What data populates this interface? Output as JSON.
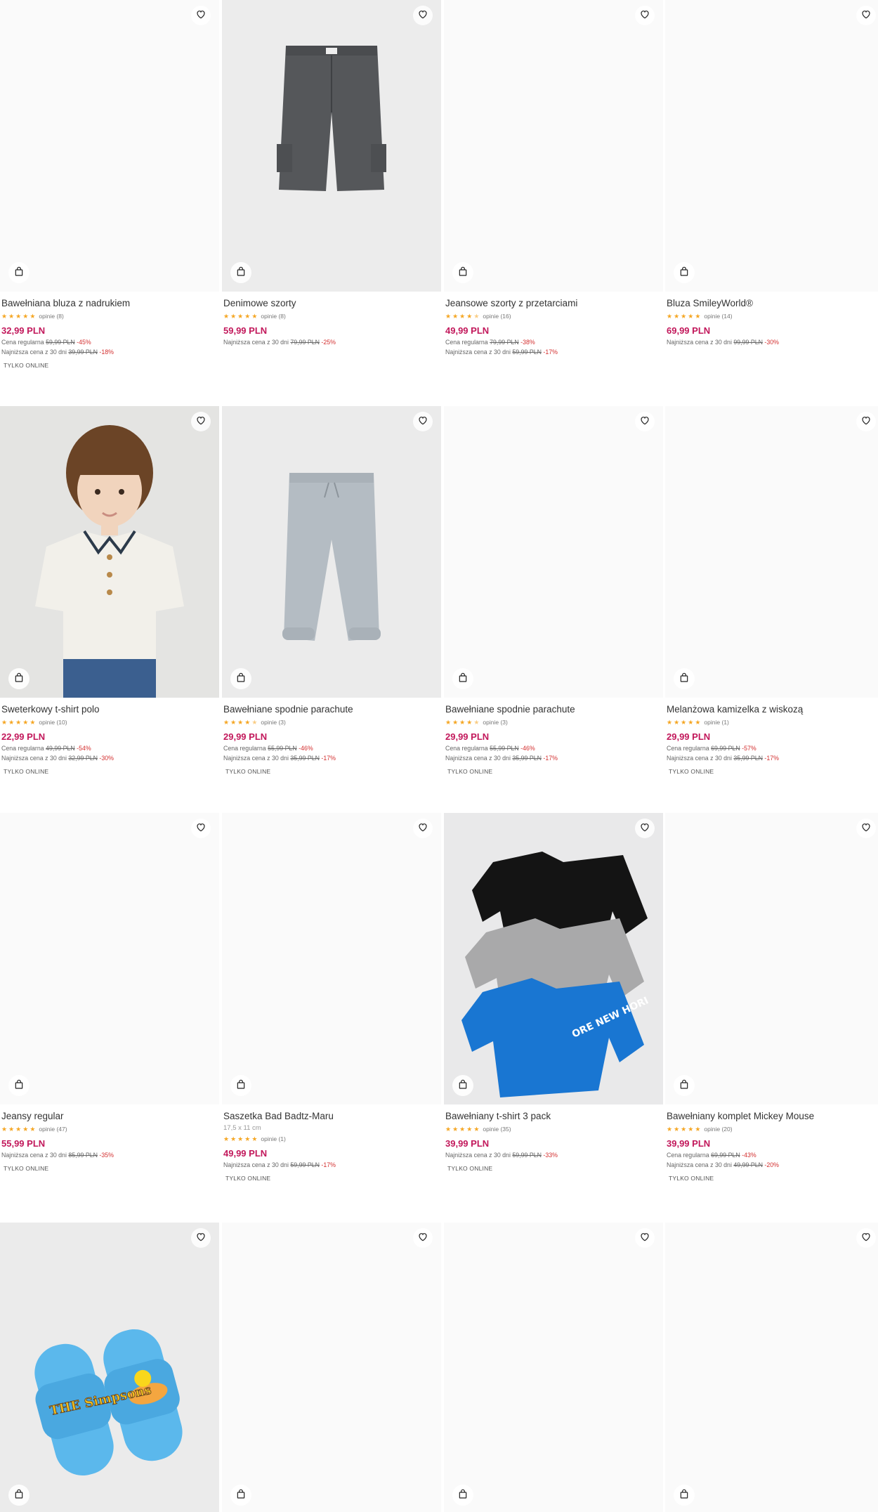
{
  "products": [
    {
      "name": "Bawełniana bluza z nadrukiem",
      "rating": 5,
      "reviews": "opinie (8)",
      "price": "32,99 PLN",
      "regular_label": "Cena regularna",
      "regular_price": "59,99 PLN",
      "regular_disc": "-45%",
      "lowest_label": "Najniższa cena z 30 dni",
      "lowest_price": "39,99 PLN",
      "lowest_disc": "-18%",
      "badge": "TYLKO ONLINE",
      "image": "none"
    },
    {
      "name": "Denimowe szorty",
      "rating": 5,
      "reviews": "opinie (8)",
      "price": "59,99 PLN",
      "lowest_label": "Najniższa cena z 30 dni",
      "lowest_price": "79,99 PLN",
      "lowest_disc": "-25%",
      "image": "shorts"
    },
    {
      "name": "Jeansowe szorty z przetarciami",
      "rating": 4.5,
      "reviews": "opinie (16)",
      "price": "49,99 PLN",
      "regular_label": "Cena regularna",
      "regular_price": "79,99 PLN",
      "regular_disc": "-38%",
      "lowest_label": "Najniższa cena z 30 dni",
      "lowest_price": "59,99 PLN",
      "lowest_disc": "-17%",
      "image": "none"
    },
    {
      "name": "Bluza SmileyWorld®",
      "rating": 5,
      "reviews": "opinie (14)",
      "price": "69,99 PLN",
      "lowest_label": "Najniższa cena z 30 dni",
      "lowest_price": "99,99 PLN",
      "lowest_disc": "-30%",
      "image": "none"
    },
    {
      "name": "Sweterkowy t-shirt polo",
      "rating": 5,
      "reviews": "opinie (10)",
      "price": "22,99 PLN",
      "regular_label": "Cena regularna",
      "regular_price": "49,99 PLN",
      "regular_disc": "-54%",
      "lowest_label": "Najniższa cena z 30 dni",
      "lowest_price": "32,99 PLN",
      "lowest_disc": "-30%",
      "badge": "TYLKO ONLINE",
      "image": "polo"
    },
    {
      "name": "Bawełniane spodnie parachute",
      "rating": 4.5,
      "reviews": "opinie (3)",
      "price": "29,99 PLN",
      "regular_label": "Cena regularna",
      "regular_price": "55,99 PLN",
      "regular_disc": "-46%",
      "lowest_label": "Najniższa cena z 30 dni",
      "lowest_price": "35,99 PLN",
      "lowest_disc": "-17%",
      "badge": "TYLKO ONLINE",
      "image": "pants"
    },
    {
      "name": "Bawełniane spodnie parachute",
      "rating": 4.5,
      "reviews": "opinie (3)",
      "price": "29,99 PLN",
      "regular_label": "Cena regularna",
      "regular_price": "55,99 PLN",
      "regular_disc": "-46%",
      "lowest_label": "Najniższa cena z 30 dni",
      "lowest_price": "35,99 PLN",
      "lowest_disc": "-17%",
      "badge": "TYLKO ONLINE",
      "image": "none"
    },
    {
      "name": "Melanżowa kamizelka z wiskozą",
      "rating": 5,
      "reviews": "opinie (1)",
      "price": "29,99 PLN",
      "regular_label": "Cena regularna",
      "regular_price": "69,99 PLN",
      "regular_disc": "-57%",
      "lowest_label": "Najniższa cena z 30 dni",
      "lowest_price": "35,99 PLN",
      "lowest_disc": "-17%",
      "badge": "TYLKO ONLINE",
      "image": "none"
    },
    {
      "name": "Jeansy regular",
      "rating": 5,
      "reviews": "opinie (47)",
      "price": "55,99 PLN",
      "lowest_label": "Najniższa cena z 30 dni",
      "lowest_price": "85,99 PLN",
      "lowest_disc": "-35%",
      "badge": "TYLKO ONLINE",
      "image": "none"
    },
    {
      "name": "Saszetka Bad Badtz-Maru",
      "dims": "17,5 x 11 cm",
      "rating": 5,
      "reviews": "opinie (1)",
      "price": "49,99 PLN",
      "lowest_label": "Najniższa cena z 30 dni",
      "lowest_price": "59,99 PLN",
      "lowest_disc": "-17%",
      "badge": "TYLKO ONLINE",
      "image": "none"
    },
    {
      "name": "Bawełniany t-shirt 3 pack",
      "rating": 5,
      "reviews": "opinie (35)",
      "price": "39,99 PLN",
      "lowest_label": "Najniższa cena z 30 dni",
      "lowest_price": "59,99 PLN",
      "lowest_disc": "-33%",
      "badge": "TYLKO ONLINE",
      "image": "tshirts"
    },
    {
      "name": "Bawełniany komplet Mickey Mouse",
      "rating": 5,
      "reviews": "opinie (20)",
      "price": "39,99 PLN",
      "regular_label": "Cena regularna",
      "regular_price": "69,99 PLN",
      "regular_disc": "-43%",
      "lowest_label": "Najniższa cena z 30 dni",
      "lowest_price": "49,99 PLN",
      "lowest_disc": "-20%",
      "badge": "TYLKO ONLINE",
      "image": "none"
    },
    {
      "image": "slides"
    },
    {
      "image": "none"
    },
    {
      "image": "none"
    },
    {
      "image": "none"
    }
  ],
  "slides_logo": "THE Simpsons",
  "colors": {
    "price": "#c2185b",
    "discount": "#d32f2f",
    "star": "#f5a623"
  },
  "icons": {
    "favorite": "heart-icon",
    "add_to_cart": "shopping-bag-icon",
    "rating": "star-icon"
  }
}
